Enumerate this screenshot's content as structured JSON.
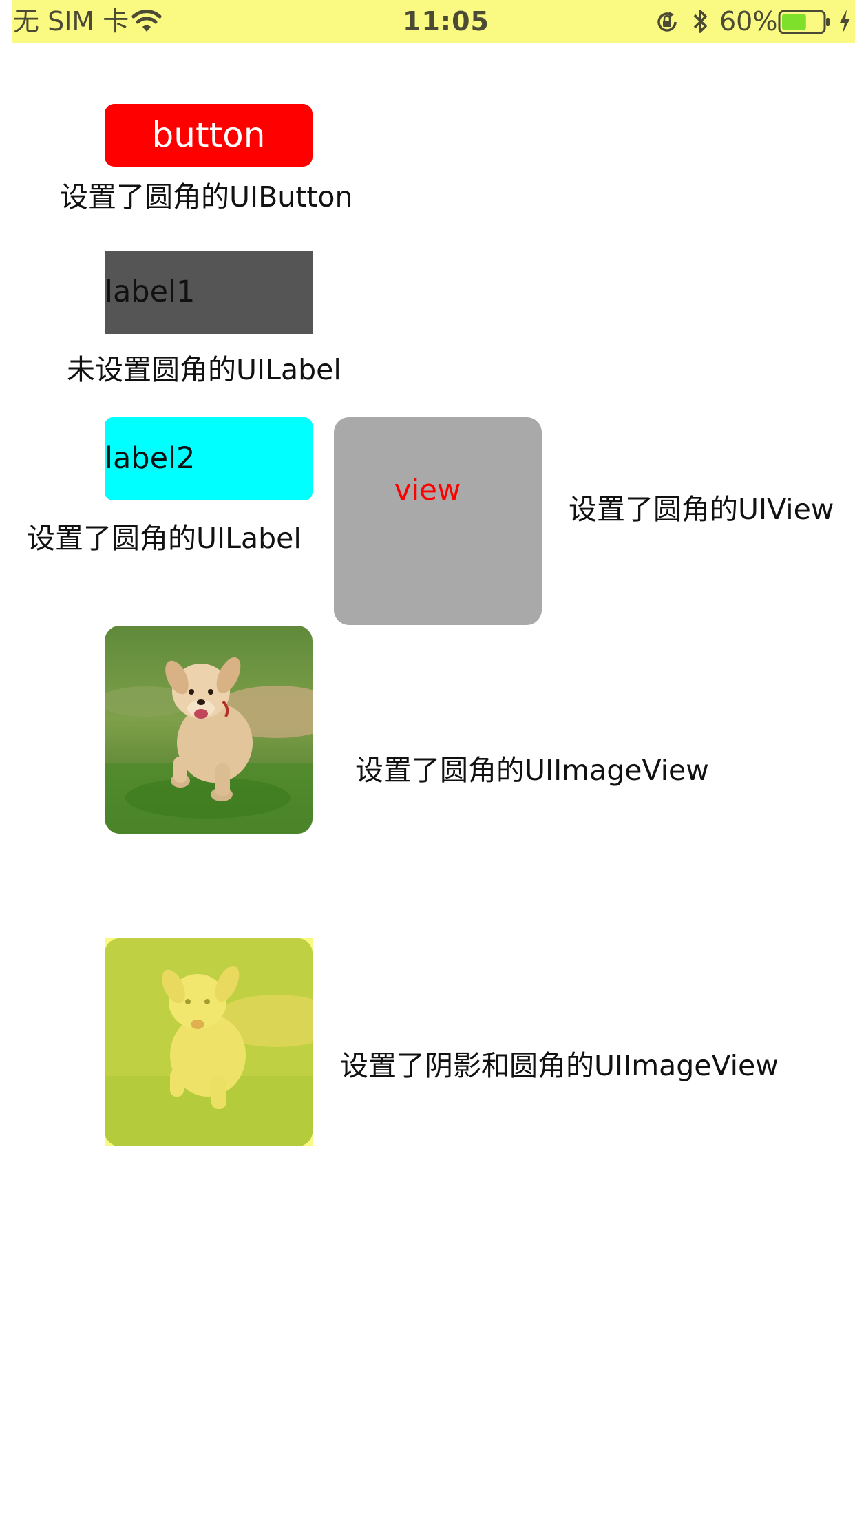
{
  "status_bar": {
    "carrier": "无 SIM 卡",
    "time": "11:05",
    "battery_percent": "60%",
    "battery_level": 0.6,
    "background": "#fafa82",
    "icons": [
      "wifi-icon",
      "orientation-lock-icon",
      "bluetooth-icon",
      "battery-icon",
      "charging-icon"
    ]
  },
  "button": {
    "label": "button",
    "background": "#ff0000",
    "caption": "设置了圆角的UIButton"
  },
  "label1": {
    "text": "label1",
    "background": "#555555",
    "caption": "未设置圆角的UILabel"
  },
  "label2": {
    "text": "label2",
    "background": "#00ffff",
    "caption": "设置了圆角的UILabel"
  },
  "view": {
    "text": "view",
    "background": "#a9a9a9",
    "text_color": "#ff0000",
    "caption": "设置了圆角的UIView"
  },
  "image_view": {
    "caption": "设置了圆角的UIImageView"
  },
  "shadow_image_view": {
    "caption": "设置了阴影和圆角的UIImageView"
  }
}
